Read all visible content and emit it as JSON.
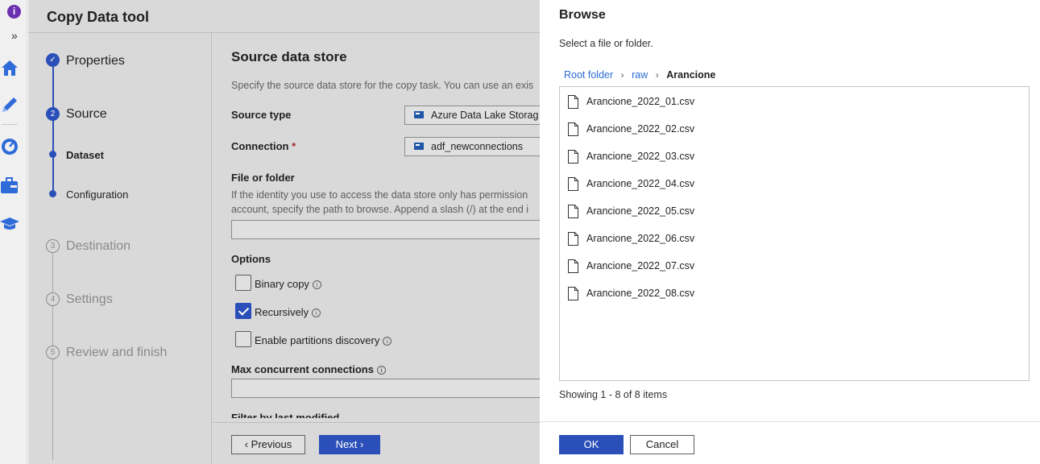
{
  "rail": {
    "icons": [
      "info-icon",
      "expand-icon",
      "home-icon",
      "author-icon",
      "monitor-icon",
      "manage-icon",
      "learn-icon"
    ]
  },
  "wizard": {
    "title": "Copy Data tool",
    "steps": [
      {
        "number": "✓",
        "label": "Properties",
        "state": "done"
      },
      {
        "number": "2",
        "label": "Source",
        "state": "current"
      },
      {
        "label": "Dataset",
        "state": "substep-current"
      },
      {
        "label": "Configuration",
        "state": "substep"
      },
      {
        "number": "3",
        "label": "Destination",
        "state": "future"
      },
      {
        "number": "4",
        "label": "Settings",
        "state": "future"
      },
      {
        "number": "5",
        "label": "Review and finish",
        "state": "future"
      }
    ],
    "content": {
      "heading": "Source data store",
      "description": "Specify the source data store for the copy task. You can use an exis",
      "source_type_label": "Source type",
      "source_type_value": "Azure Data Lake Storag",
      "connection_label": "Connection",
      "connection_required": "*",
      "connection_value": "adf_newconnections",
      "file_folder_label": "File or folder",
      "file_folder_note_1": "If the identity you use to access the data store only has permission",
      "file_folder_note_2": "account, specify the path to browse. Append a slash (/) at the end i",
      "file_folder_value": "",
      "options_label": "Options",
      "options": [
        {
          "label": "Binary copy",
          "checked": false
        },
        {
          "label": "Recursively",
          "checked": true
        },
        {
          "label": "Enable partitions discovery",
          "checked": false
        }
      ],
      "max_conn_label": "Max concurrent connections",
      "max_conn_value": "",
      "filter_label": "Filter by last modified"
    },
    "footer": {
      "previous": "‹ Previous",
      "next": "Next ›"
    }
  },
  "browse": {
    "title": "Browse",
    "subtitle": "Select a file or folder.",
    "breadcrumb": {
      "root": "Root folder",
      "raw": "raw",
      "current": "Arancione",
      "separator": "›"
    },
    "files": [
      "Arancione_2022_01.csv",
      "Arancione_2022_02.csv",
      "Arancione_2022_03.csv",
      "Arancione_2022_04.csv",
      "Arancione_2022_05.csv",
      "Arancione_2022_06.csv",
      "Arancione_2022_07.csv",
      "Arancione_2022_08.csv"
    ],
    "count": "Showing 1 - 8 of 8 items",
    "ok": "OK",
    "cancel": "Cancel"
  },
  "colors": {
    "accent": "#2b4fb8",
    "link": "#2b6cd4",
    "overlay": "#d9d9d9"
  }
}
